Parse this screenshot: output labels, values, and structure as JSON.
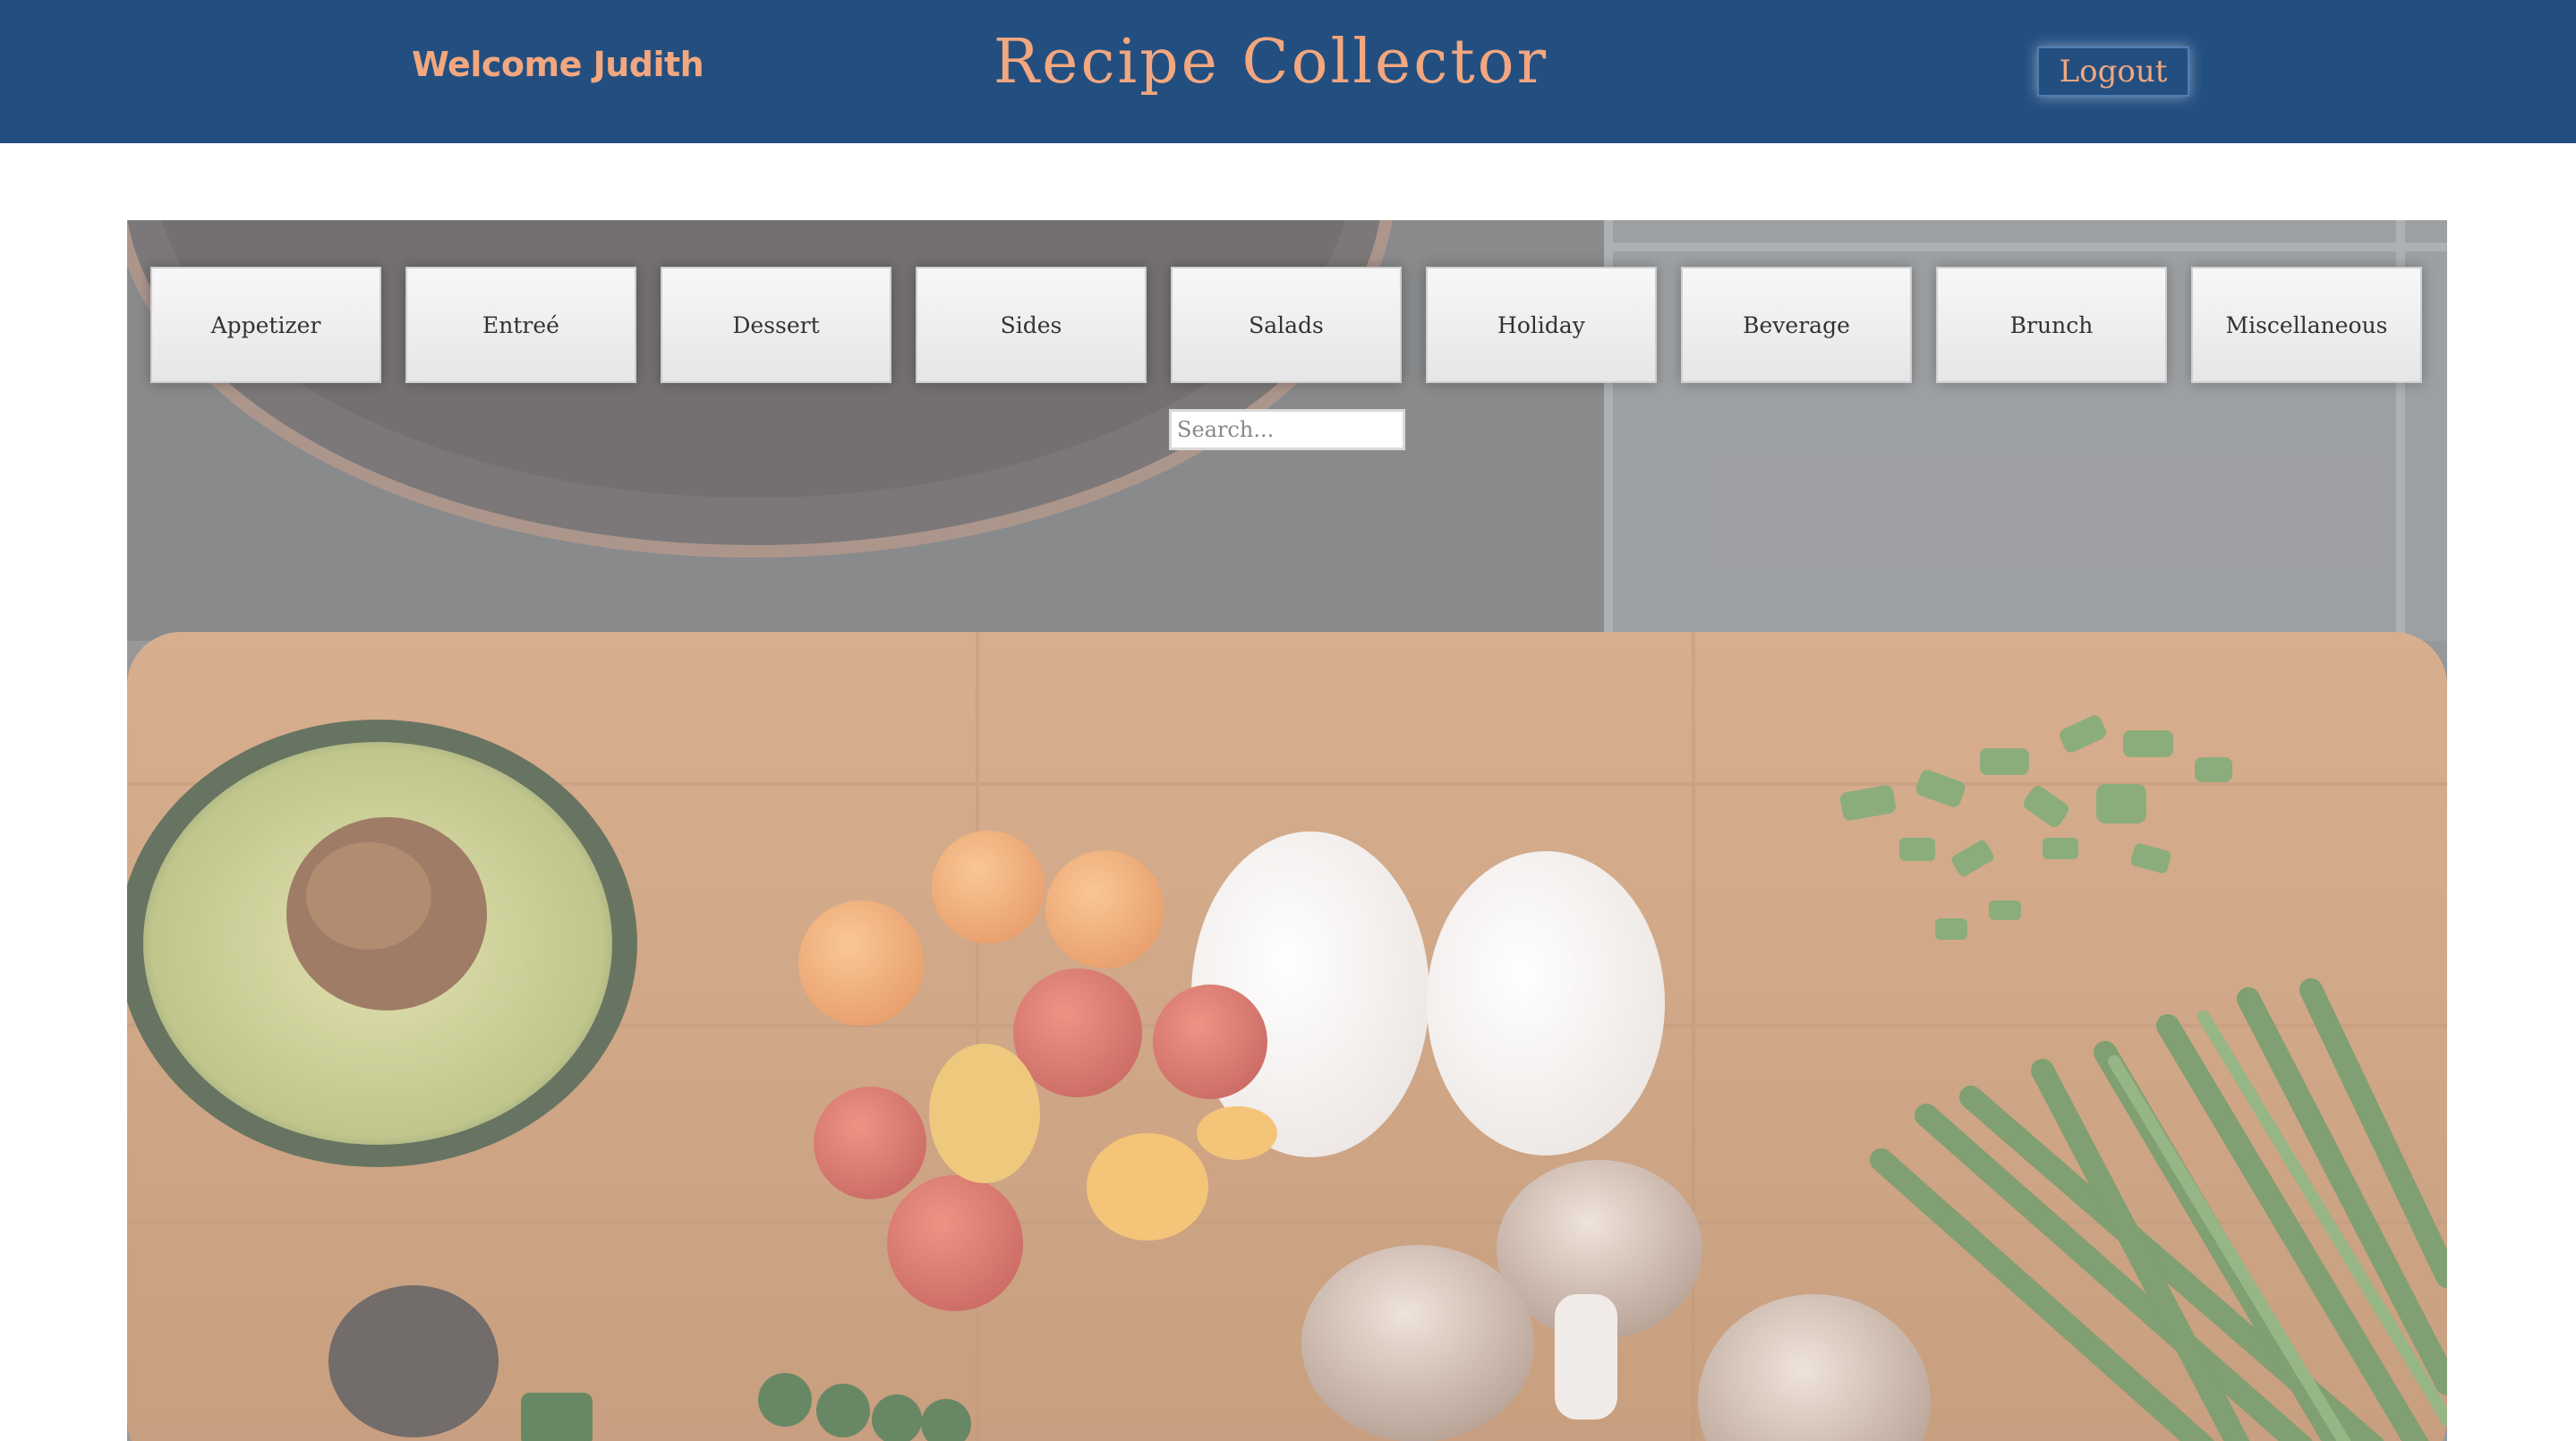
{
  "header": {
    "welcome": "Welcome Judith",
    "title": "Recipe Collector",
    "logout_label": "Logout"
  },
  "categories": [
    "Appetizer",
    "Entreé",
    "Dessert",
    "Sides",
    "Salads",
    "Holiday",
    "Beverage",
    "Brunch",
    "Miscellaneous"
  ],
  "search": {
    "placeholder": "Search...",
    "value": ""
  },
  "colors": {
    "header_bg": "#234f80",
    "accent_text": "#f2a77f"
  }
}
